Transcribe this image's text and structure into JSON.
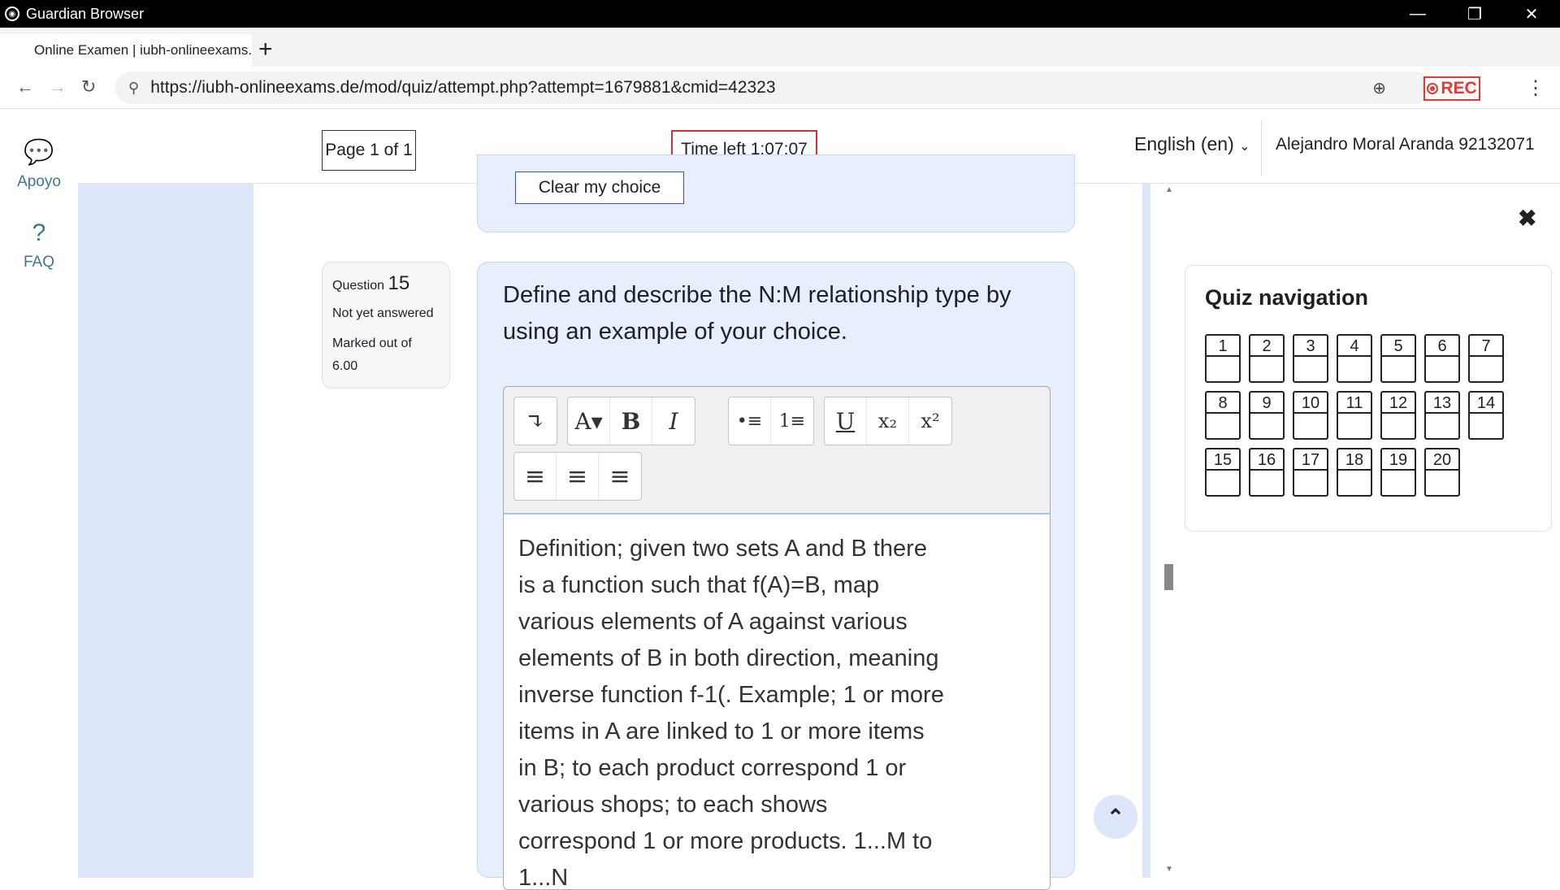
{
  "window": {
    "title": "Guardian Browser",
    "minimize": "—",
    "restore": "❐",
    "close": "✕"
  },
  "tab": {
    "label": "Online Examen | iubh-onlineexams.de",
    "new_tab": "+"
  },
  "nav": {
    "back": "←",
    "forward": "→",
    "reload": "↻",
    "url": "https://iubh-onlineexams.de/mod/quiz/attempt.php?attempt=1679881&cmid=42323",
    "rec": "REC",
    "menu": "⋮"
  },
  "leftrail": {
    "items": [
      {
        "icon": "chat-icon",
        "label": "Apoyo"
      },
      {
        "icon": "help-icon",
        "label": "FAQ"
      }
    ]
  },
  "header": {
    "page": "Page 1 of 1",
    "time_left": "Time left 1:07:07",
    "language": "English (en)",
    "user": "Alejandro Moral Aranda 92132071"
  },
  "prev": {
    "clear_choice": "Clear my choice"
  },
  "question": {
    "label": "Question",
    "number": "15",
    "status": "Not yet answered",
    "marked": "Marked out of 6.00",
    "text": "Define and describe the N:M relationship type by using an example of your choice."
  },
  "editor": {
    "toolbar": [
      "↴",
      "A▾",
      "B",
      "I",
      "•≡",
      "1≡",
      "U",
      "x₂",
      "x²",
      "≡",
      "≡",
      "≡"
    ],
    "lines": [
      "Definition; given two sets A and B  there",
      "is a function such that f(A)=B, map",
      "various elements of A against various",
      "elements of B in both direction, meaning",
      "inverse function f-1(. Example; 1 or more",
      "items in A are linked to 1 or more items",
      "in B; to each product correspond 1 or",
      "various shops; to each shows",
      "correspond 1 or more products. 1...M to",
      "1...N"
    ]
  },
  "quiz_nav": {
    "title": "Quiz navigation",
    "close": "✖",
    "questions": [
      "1",
      "2",
      "3",
      "4",
      "5",
      "6",
      "7",
      "8",
      "9",
      "10",
      "11",
      "12",
      "13",
      "14",
      "15",
      "16",
      "17",
      "18",
      "19",
      "20"
    ]
  },
  "back_to_top": "⌃"
}
